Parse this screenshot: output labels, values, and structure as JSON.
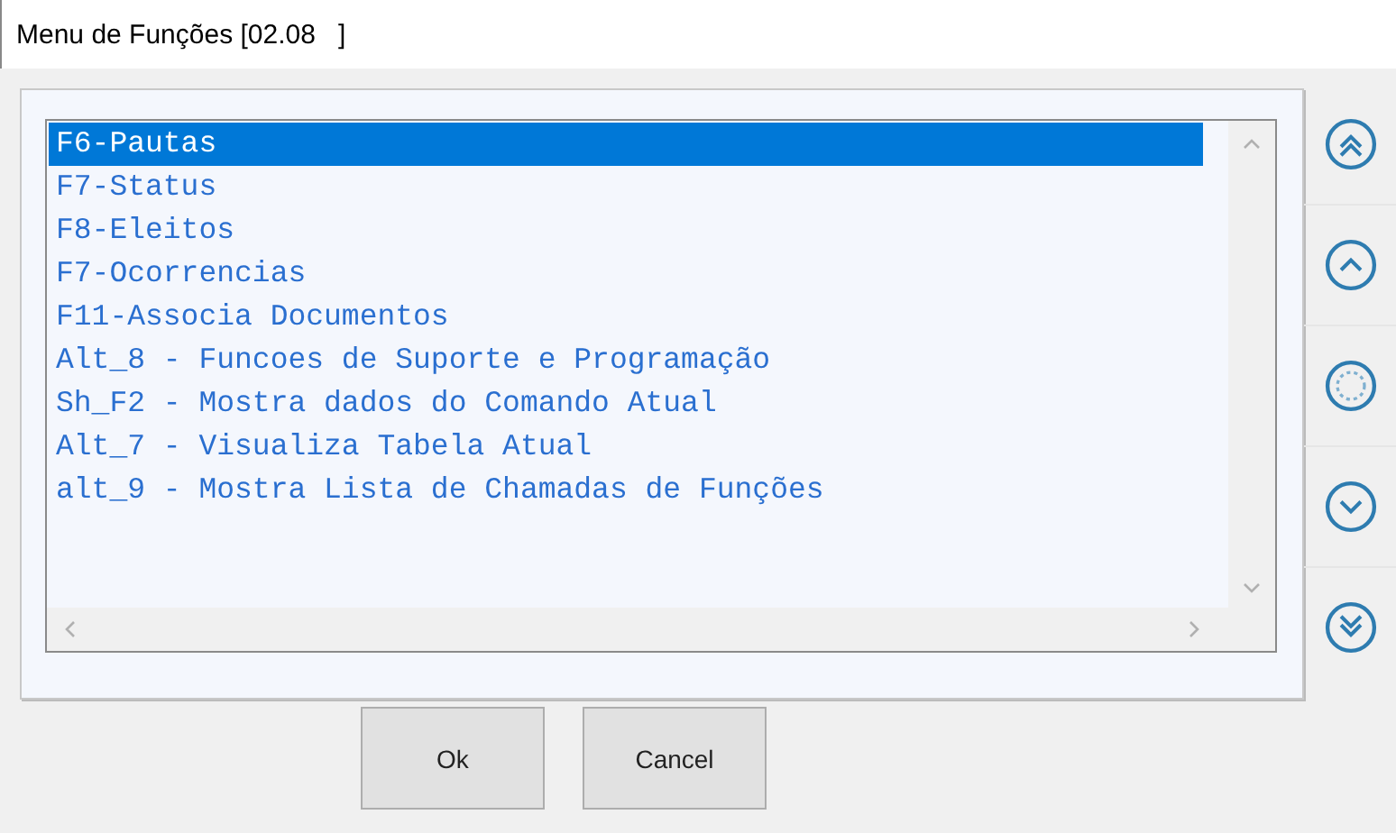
{
  "window": {
    "title": "Menu de Funções [02.08   ]"
  },
  "list": {
    "items": [
      {
        "label": "F6-Pautas",
        "selected": true
      },
      {
        "label": "F7-Status",
        "selected": false
      },
      {
        "label": "F8-Eleitos",
        "selected": false
      },
      {
        "label": "F7-Ocorrencias",
        "selected": false
      },
      {
        "label": "F11-Associa Documentos",
        "selected": false
      },
      {
        "label": "Alt_8 - Funcoes de Suporte e Programação",
        "selected": false
      },
      {
        "label": "Sh_F2 - Mostra dados do Comando Atual",
        "selected": false
      },
      {
        "label": "Alt_7 - Visualiza Tabela Atual",
        "selected": false
      },
      {
        "label": "alt_9 - Mostra Lista de Chamadas de Funções",
        "selected": false
      }
    ]
  },
  "nav_buttons": [
    {
      "kind": "first"
    },
    {
      "kind": "up"
    },
    {
      "kind": "center"
    },
    {
      "kind": "down"
    },
    {
      "kind": "last"
    }
  ],
  "buttons": [
    {
      "label": "Ok"
    },
    {
      "label": "Cancel"
    }
  ]
}
